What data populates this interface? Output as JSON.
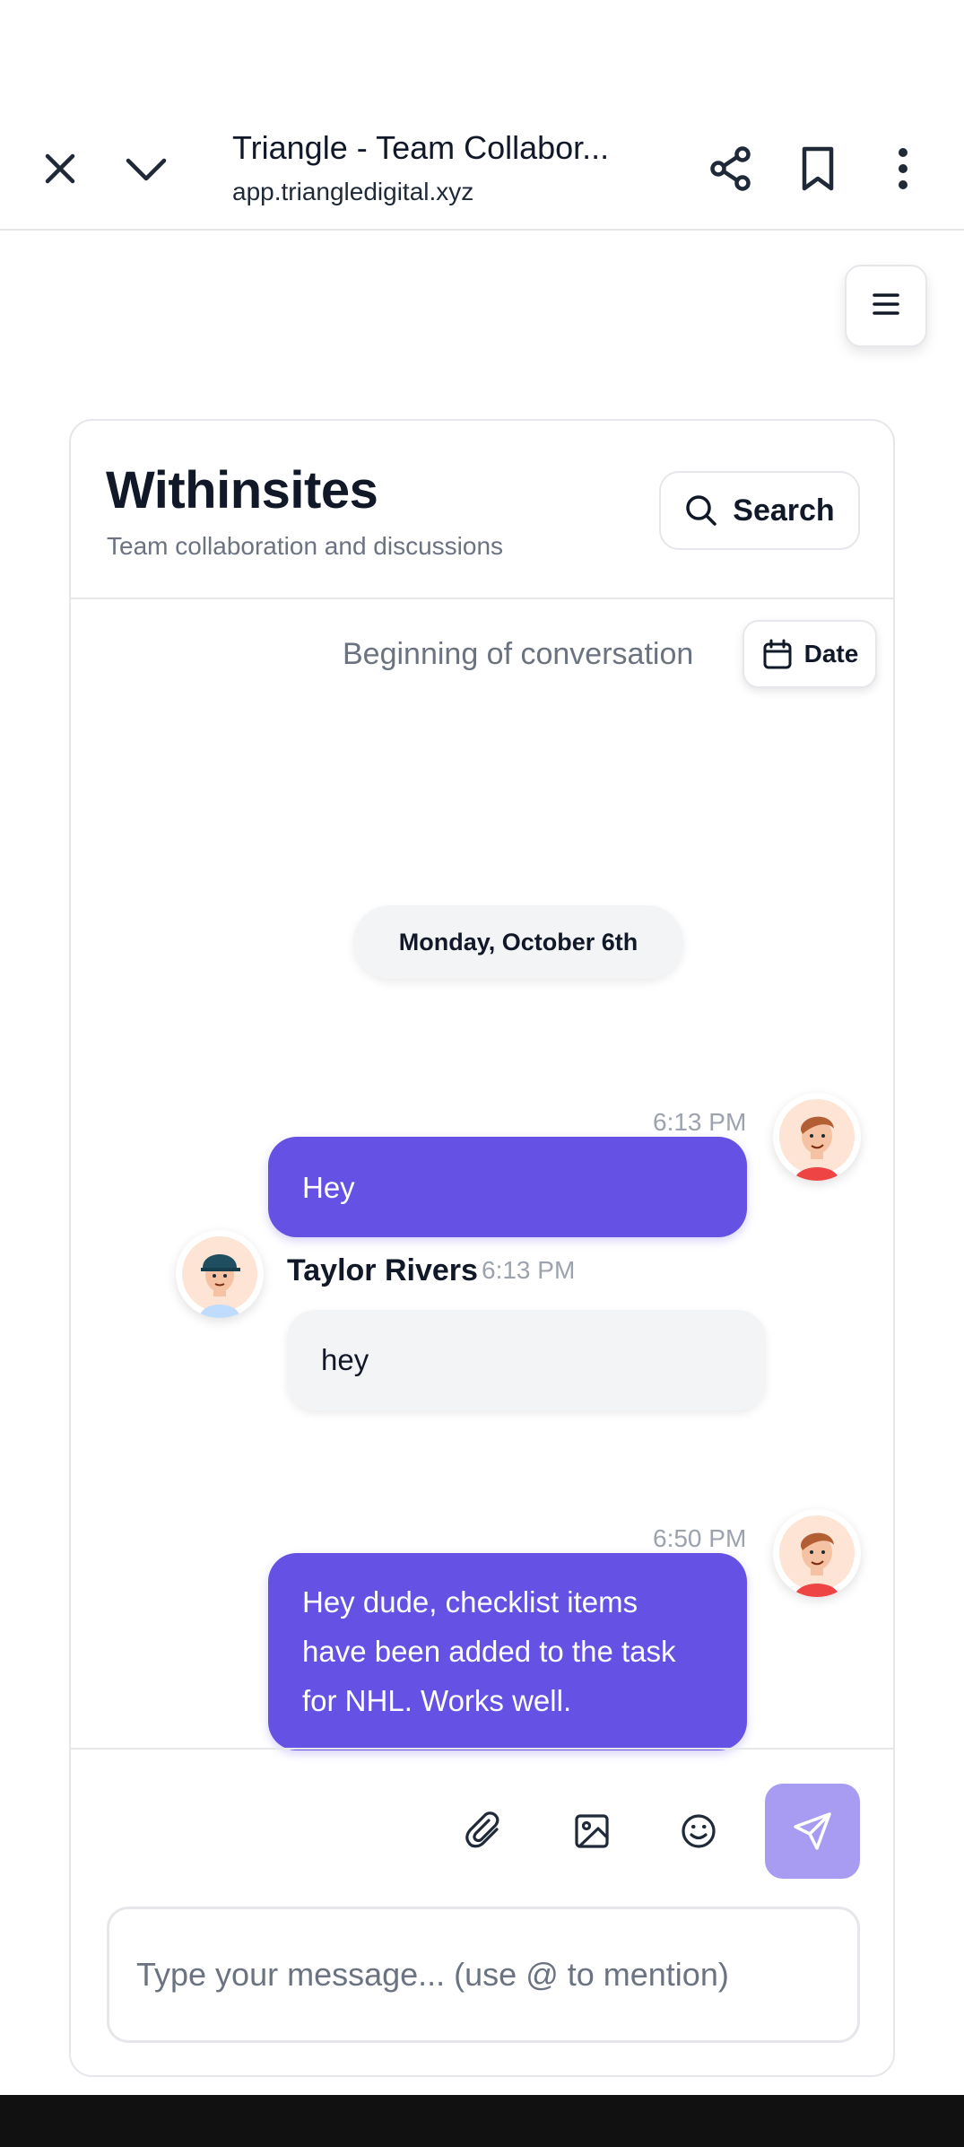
{
  "browser": {
    "title": "Triangle - Team Collabor...",
    "url": "app.triangledigital.xyz",
    "icons": [
      "close-icon",
      "chevron-down-icon",
      "share-icon",
      "bookmark-icon",
      "more-vert-icon"
    ]
  },
  "menu": {
    "icon": "hamburger-icon"
  },
  "header": {
    "title": "Withinsites",
    "subtitle": "Team collaboration and discussions",
    "search_label": "Search"
  },
  "conversation": {
    "beginning_label": "Beginning of conversation",
    "date_button_label": "Date",
    "day_separator": "Monday, October 6th",
    "messages": [
      {
        "direction": "outgoing",
        "time": "6:13 PM",
        "text": "Hey"
      },
      {
        "direction": "incoming",
        "sender": "Taylor Rivers",
        "time": "6:13 PM",
        "text": "hey"
      },
      {
        "direction": "outgoing",
        "time": "6:50 PM",
        "text": "Hey dude, checklist items have been added to the task for NHL. Works well."
      }
    ]
  },
  "composer": {
    "placeholder": "Type your message... (use @ to mention)",
    "tools": [
      "paperclip-icon",
      "image-icon",
      "emoji-icon"
    ],
    "send_icon": "send-icon"
  },
  "colors": {
    "accent": "#6551e3",
    "send_button": "#a79cf1",
    "incoming_bubble": "#f3f4f6",
    "border": "#e5e7eb"
  }
}
